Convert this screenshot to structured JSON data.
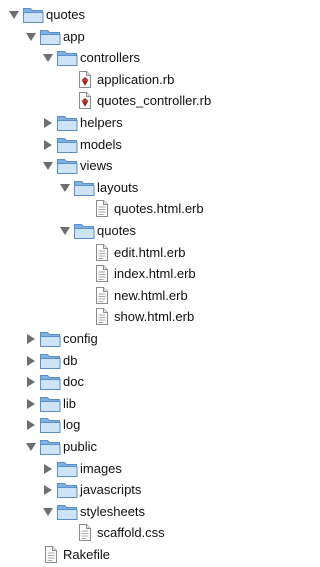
{
  "tree": [
    {
      "label": "quotes",
      "type": "folder",
      "depth": 0,
      "expanded": true
    },
    {
      "label": "app",
      "type": "folder",
      "depth": 1,
      "expanded": true
    },
    {
      "label": "controllers",
      "type": "folder",
      "depth": 2,
      "expanded": true
    },
    {
      "label": "application.rb",
      "type": "ruby-file",
      "depth": 3
    },
    {
      "label": "quotes_controller.rb",
      "type": "ruby-file",
      "depth": 3
    },
    {
      "label": "helpers",
      "type": "folder",
      "depth": 2,
      "expanded": false
    },
    {
      "label": "models",
      "type": "folder",
      "depth": 2,
      "expanded": false
    },
    {
      "label": "views",
      "type": "folder",
      "depth": 2,
      "expanded": true
    },
    {
      "label": "layouts",
      "type": "folder",
      "depth": 3,
      "expanded": true
    },
    {
      "label": "quotes.html.erb",
      "type": "text-file",
      "depth": 4
    },
    {
      "label": "quotes",
      "type": "folder",
      "depth": 3,
      "expanded": true
    },
    {
      "label": "edit.html.erb",
      "type": "text-file",
      "depth": 4
    },
    {
      "label": "index.html.erb",
      "type": "text-file",
      "depth": 4
    },
    {
      "label": "new.html.erb",
      "type": "text-file",
      "depth": 4
    },
    {
      "label": "show.html.erb",
      "type": "text-file",
      "depth": 4
    },
    {
      "label": "config",
      "type": "folder",
      "depth": 1,
      "expanded": false
    },
    {
      "label": "db",
      "type": "folder",
      "depth": 1,
      "expanded": false
    },
    {
      "label": "doc",
      "type": "folder",
      "depth": 1,
      "expanded": false
    },
    {
      "label": "lib",
      "type": "folder",
      "depth": 1,
      "expanded": false
    },
    {
      "label": "log",
      "type": "folder",
      "depth": 1,
      "expanded": false
    },
    {
      "label": "public",
      "type": "folder",
      "depth": 1,
      "expanded": true
    },
    {
      "label": "images",
      "type": "folder",
      "depth": 2,
      "expanded": false
    },
    {
      "label": "javascripts",
      "type": "folder",
      "depth": 2,
      "expanded": false
    },
    {
      "label": "stylesheets",
      "type": "folder",
      "depth": 2,
      "expanded": true
    },
    {
      "label": "scaffold.css",
      "type": "text-file",
      "depth": 3
    },
    {
      "label": "Rakefile",
      "type": "text-file",
      "depth": 1
    }
  ],
  "colors": {
    "folder_light": "#cfe3f7",
    "folder_dark": "#7fb0e2",
    "folder_edge": "#5a8fc8",
    "triangle": "#6e6e6e",
    "ruby_red": "#b0221c"
  }
}
